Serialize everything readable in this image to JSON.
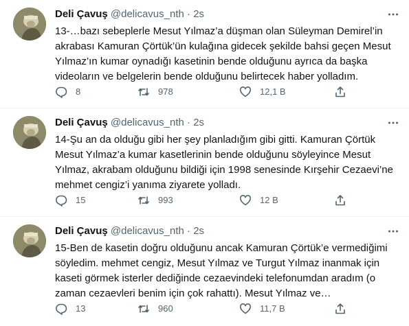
{
  "tweets": [
    {
      "author": "Deli Çavuş",
      "handle": "@delicavus_nth",
      "separator": "·",
      "time": "2s",
      "text": "13-…bazı sebeplerle Mesut Yılmaz’a düşman olan Süleyman Demirel’in akrabası Kamuran Çörtük’ün kulağına gidecek şekilde bahsi geçen Mesut Yılmaz’ın kumar oynadığı kasetinin bende olduğunu ayrıca da başka videoların ve belgelerin bende olduğunu belirtecek haber yolladım.",
      "replies": "8",
      "retweets": "978",
      "likes": "12,1 B"
    },
    {
      "author": "Deli Çavuş",
      "handle": "@delicavus_nth",
      "separator": "·",
      "time": "2s",
      "text": "14-Şu an da olduğu gibi her şey planladığım gibi gitti. Kamuran Çörtük Mesut Yılmaz’a kumar kasetlerinin bende olduğunu söyleyince Mesut Yılmaz, akrabam olduğunu bildiği için 1998 senesinde Kırşehir Cezaevi’ne mehmet cengiz’i yanıma ziyarete yolladı.",
      "replies": "15",
      "retweets": "993",
      "likes": "12 B"
    },
    {
      "author": "Deli Çavuş",
      "handle": "@delicavus_nth",
      "separator": "·",
      "time": "2s",
      "text": "15-Ben de kasetin doğru olduğunu ancak Kamuran Çörtük’e vermediğimi söyledim. mehmet cengiz, Mesut Yılmaz ve Turgut Yılmaz inanmak için kaseti görmek isterler dediğinde cezaevindeki telefonumdan aradım (o zaman cezaevleri benim için çok rahattı). Mesut Yılmaz ve…",
      "replies": "13",
      "retweets": "960",
      "likes": "11,7 B"
    }
  ],
  "icons": {
    "reply": "reply-icon",
    "retweet": "retweet-icon",
    "like": "heart-icon",
    "share": "share-icon",
    "more": "more-icon"
  }
}
